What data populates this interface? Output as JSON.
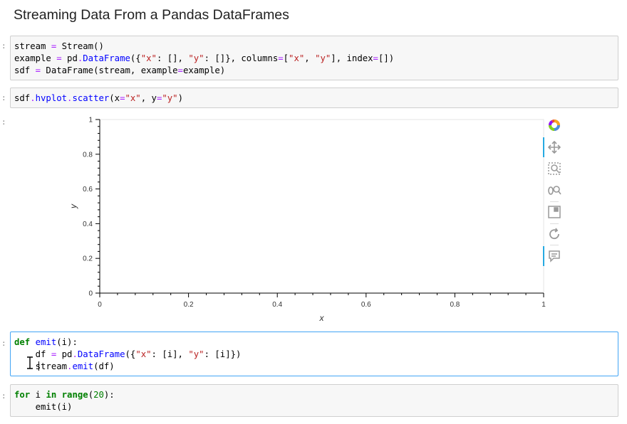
{
  "notebook": {
    "heading": "Streaming Data From a Pandas DataFrames",
    "prompt_char": ":"
  },
  "cells": [
    {
      "type": "code",
      "lines": [
        [
          {
            "t": "stream ",
            "c": ""
          },
          {
            "t": "=",
            "c": "op"
          },
          {
            "t": " Stream()",
            "c": ""
          }
        ],
        [
          {
            "t": "example ",
            "c": ""
          },
          {
            "t": "=",
            "c": "op"
          },
          {
            "t": " pd",
            "c": ""
          },
          {
            "t": ".",
            "c": "op"
          },
          {
            "t": "DataFrame",
            "c": "cls"
          },
          {
            "t": "({",
            "c": ""
          },
          {
            "t": "\"x\"",
            "c": "str"
          },
          {
            "t": ": [], ",
            "c": ""
          },
          {
            "t": "\"y\"",
            "c": "str"
          },
          {
            "t": ": []}, columns",
            "c": ""
          },
          {
            "t": "=",
            "c": "op"
          },
          {
            "t": "[",
            "c": ""
          },
          {
            "t": "\"x\"",
            "c": "str"
          },
          {
            "t": ", ",
            "c": ""
          },
          {
            "t": "\"y\"",
            "c": "str"
          },
          {
            "t": "], index",
            "c": ""
          },
          {
            "t": "=",
            "c": "op"
          },
          {
            "t": "[])",
            "c": ""
          }
        ],
        [
          {
            "t": "sdf ",
            "c": ""
          },
          {
            "t": "=",
            "c": "op"
          },
          {
            "t": " DataFrame(stream, example",
            "c": ""
          },
          {
            "t": "=",
            "c": "op"
          },
          {
            "t": "example)",
            "c": ""
          }
        ]
      ]
    },
    {
      "type": "code",
      "lines": [
        [
          {
            "t": "sdf",
            "c": ""
          },
          {
            "t": ".",
            "c": "op"
          },
          {
            "t": "hvplot",
            "c": "fn"
          },
          {
            "t": ".",
            "c": "op"
          },
          {
            "t": "scatter",
            "c": "fn"
          },
          {
            "t": "(x",
            "c": ""
          },
          {
            "t": "=",
            "c": "op"
          },
          {
            "t": "\"x\"",
            "c": "str"
          },
          {
            "t": ", y",
            "c": ""
          },
          {
            "t": "=",
            "c": "op"
          },
          {
            "t": "\"y\"",
            "c": "str"
          },
          {
            "t": ")",
            "c": ""
          }
        ]
      ]
    },
    {
      "type": "code",
      "selected": true,
      "lines": [
        [
          {
            "t": "def",
            "c": "kw"
          },
          {
            "t": " ",
            "c": ""
          },
          {
            "t": "emit",
            "c": "fn"
          },
          {
            "t": "(i):",
            "c": ""
          }
        ],
        [
          {
            "t": "    df ",
            "c": ""
          },
          {
            "t": "=",
            "c": "op"
          },
          {
            "t": " pd",
            "c": ""
          },
          {
            "t": ".",
            "c": "op"
          },
          {
            "t": "DataFrame",
            "c": "cls"
          },
          {
            "t": "({",
            "c": ""
          },
          {
            "t": "\"x\"",
            "c": "str"
          },
          {
            "t": ": [i], ",
            "c": ""
          },
          {
            "t": "\"y\"",
            "c": "str"
          },
          {
            "t": ": [i]})",
            "c": ""
          }
        ],
        [
          {
            "t": "    stream",
            "c": ""
          },
          {
            "t": ".",
            "c": "op"
          },
          {
            "t": "emit",
            "c": "fn"
          },
          {
            "t": "(df)",
            "c": ""
          }
        ]
      ]
    },
    {
      "type": "code",
      "lines": [
        [
          {
            "t": "for",
            "c": "kw"
          },
          {
            "t": " i ",
            "c": ""
          },
          {
            "t": "in",
            "c": "kw"
          },
          {
            "t": " ",
            "c": ""
          },
          {
            "t": "range",
            "c": "kw"
          },
          {
            "t": "(",
            "c": ""
          },
          {
            "t": "20",
            "c": "num"
          },
          {
            "t": "):",
            "c": ""
          }
        ],
        [
          {
            "t": "    emit(i)",
            "c": ""
          }
        ]
      ]
    }
  ],
  "chart_data": {
    "type": "scatter",
    "x": [],
    "y": [],
    "xlabel": "x",
    "ylabel": "y",
    "xlim": [
      0,
      1
    ],
    "ylim": [
      0,
      1
    ],
    "xticks": [
      "0",
      "0.2",
      "0.4",
      "0.6",
      "0.8",
      "1"
    ],
    "yticks": [
      "0",
      "0.2",
      "0.4",
      "0.6",
      "0.8",
      "1"
    ],
    "grid": false
  },
  "toolbar": {
    "tools": [
      "bokeh-logo-icon",
      "pan-icon",
      "box-zoom-icon",
      "wheel-zoom-icon",
      "save-icon",
      "reset-icon",
      "hover-icon"
    ],
    "accent": "#26aae1"
  }
}
